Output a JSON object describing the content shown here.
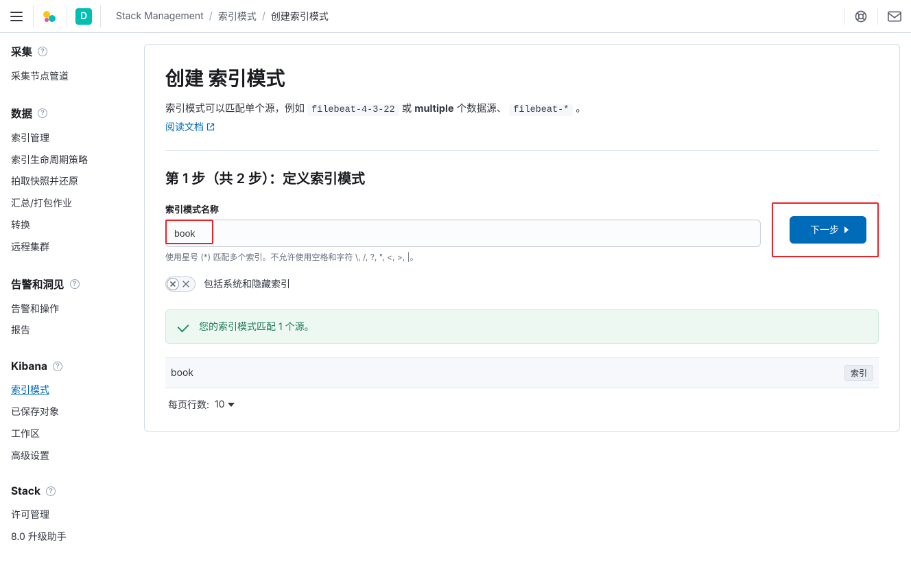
{
  "header": {
    "space_initial": "D",
    "breadcrumbs": [
      "Stack Management",
      "索引模式",
      "创建索引模式"
    ]
  },
  "sidebar": {
    "sections": [
      {
        "title": "采集",
        "items": [
          "采集节点管道"
        ]
      },
      {
        "title": "数据",
        "items": [
          "索引管理",
          "索引生命周期策略",
          "拍取快照并还原",
          "汇总/打包作业",
          "转换",
          "远程集群"
        ]
      },
      {
        "title": "告警和洞见",
        "items": [
          "告警和操作",
          "报告"
        ]
      },
      {
        "title": "Kibana",
        "items": [
          "索引模式",
          "已保存对象",
          "工作区",
          "高级设置"
        ],
        "activeIndex": 0
      },
      {
        "title": "Stack",
        "items": [
          "许可管理",
          "8.0 升级助手"
        ]
      }
    ]
  },
  "page": {
    "title_prefix": "创建 ",
    "title_object": "索引模式",
    "desc_1": "索引模式可以匹配单个源，例如 ",
    "code_1": "filebeat-4-3-22",
    "desc_2": " 或 ",
    "desc_bold": "multiple",
    "desc_3": " 个数据源、",
    "code_2": "filebeat-*",
    "desc_4": " 。",
    "doc_link": "阅读文档",
    "step_title": "第 1 步（共 2 步）：定义索引模式",
    "field_label": "索引模式名称",
    "input_value": "book",
    "help_text": "使用星号 (*) 匹配多个索引。不允许使用空格和字符 \\, /, ?, \", <, >, |。",
    "switch_label": "包括系统和隐藏索引",
    "next_button": "下一步",
    "callout": "您的索引模式匹配 1 个源。",
    "match_name": "book",
    "match_badge": "索引",
    "pager_label": "每页行数:",
    "pager_value": "10"
  }
}
